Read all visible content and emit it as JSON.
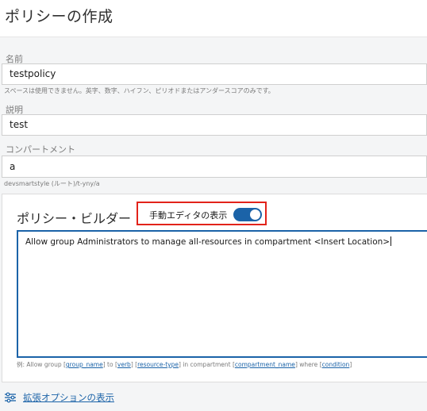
{
  "page": {
    "title": "ポリシーの作成"
  },
  "form": {
    "name": {
      "label": "名前",
      "value": "testpolicy",
      "hint": "スペースは使用できません。英字、数字、ハイフン、ピリオドまたはアンダースコアのみです。"
    },
    "description": {
      "label": "説明",
      "value": "test"
    },
    "compartment": {
      "label": "コンパートメント",
      "value": "a",
      "path": "devsmartstyle (ルート)/t-yny/a"
    }
  },
  "builder": {
    "title": "ポリシー・ビルダー",
    "manual_editor_label": "手動エディタの表示",
    "manual_editor_enabled": true,
    "policy_text": "Allow group Administrators to manage all-resources in compartment <Insert Location>",
    "example": {
      "prefix": "例: Allow group ",
      "group_name": "group_name",
      "to": " to ",
      "verb": "verb",
      "space": " ",
      "resource_type": "resource-type",
      "in_compartment": " in compartment ",
      "compartment_name": "compartment_name",
      "where": " where ",
      "condition": "condition"
    }
  },
  "advanced": {
    "label": "拡張オプションの表示",
    "icon": "sliders-icon"
  },
  "colors": {
    "accent": "#1b63a8",
    "highlight": "#e2231a"
  }
}
